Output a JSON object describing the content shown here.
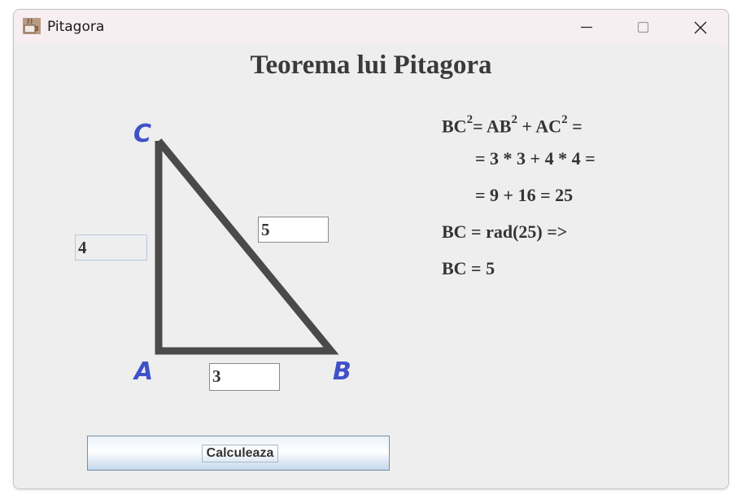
{
  "window": {
    "title": "Pitagora",
    "heading": "Teorema lui Pitagora"
  },
  "triangle": {
    "vertex_a": "A",
    "vertex_b": "B",
    "vertex_c": "C",
    "ab_value": "3",
    "ac_value": "4",
    "bc_value": "5"
  },
  "formula": {
    "line1": {
      "bc": "BC",
      "exp1": "2",
      "eq_ab": "= AB",
      "exp2": "2",
      "plus_ac": " + AC",
      "exp3": "2",
      "eq": " ="
    },
    "line2": "= 3 * 3 + 4 * 4 =",
    "line3": "= 9 + 16 = 25",
    "line4": "BC = rad(25) =>",
    "line5": "BC = 5"
  },
  "button": {
    "label": "Calculeaza"
  },
  "colors": {
    "vertex_label": "#3f51c9",
    "triangle_stroke": "#4a4a4a",
    "titlebar": "#f7eef2",
    "window_bg": "#eeeeee"
  },
  "icons": {
    "app": "coffee-cup-icon",
    "minimize": "minimize-icon",
    "maximize": "maximize-icon",
    "close": "close-icon"
  }
}
